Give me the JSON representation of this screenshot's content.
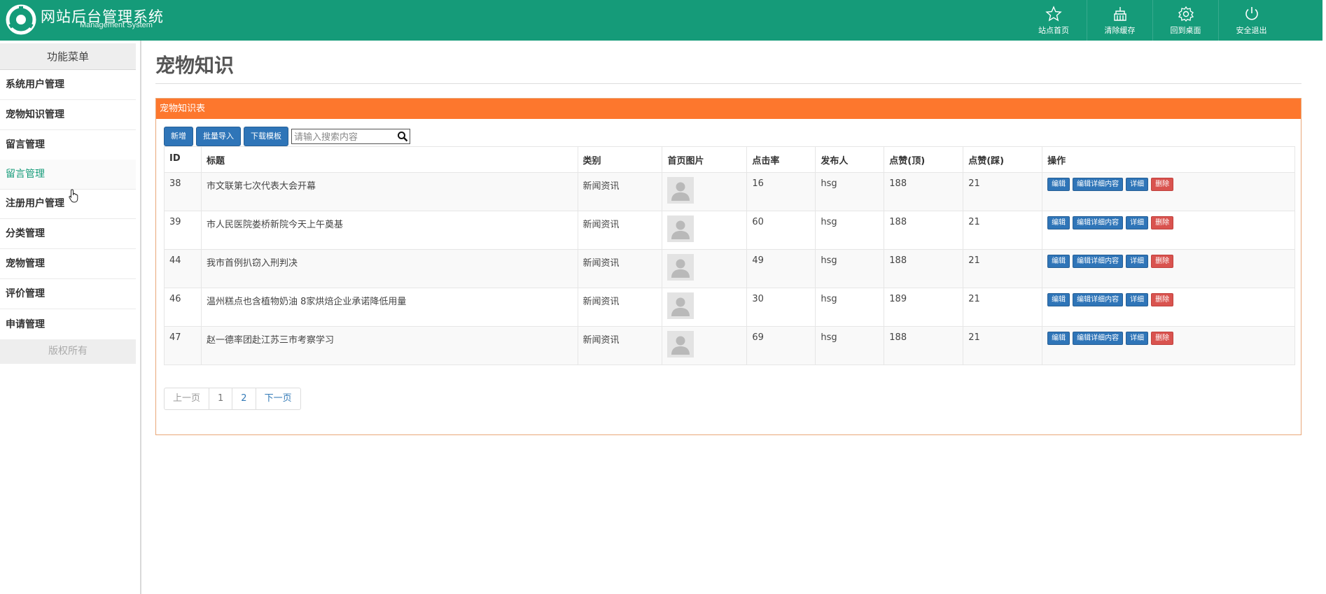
{
  "header": {
    "title": "网站后台管理系统",
    "subtitle": "Management System",
    "nav": [
      {
        "label": "站点首页",
        "icon": "star-icon"
      },
      {
        "label": "清除缓存",
        "icon": "broom-icon"
      },
      {
        "label": "回到桌面",
        "icon": "gear-icon"
      },
      {
        "label": "安全退出",
        "icon": "power-icon"
      }
    ]
  },
  "sidebar": {
    "heading": "功能菜单",
    "items": [
      {
        "label": "系统用户管理"
      },
      {
        "label": "宠物知识管理"
      },
      {
        "label": "留言管理"
      },
      {
        "label": "留言管理"
      },
      {
        "label": "注册用户管理"
      },
      {
        "label": "分类管理"
      },
      {
        "label": "宠物管理"
      },
      {
        "label": "评价管理"
      },
      {
        "label": "申请管理"
      }
    ],
    "footer": "版权所有"
  },
  "main": {
    "page_title": "宠物知识",
    "panel_title": "宠物知识表",
    "toolbar": {
      "add": "新增",
      "import": "批量导入",
      "template": "下载模板",
      "search_placeholder": "请输入搜索内容"
    },
    "table": {
      "columns": [
        "ID",
        "标题",
        "类别",
        "首页图片",
        "点击率",
        "发布人",
        "点赞(顶)",
        "点赞(踩)",
        "操作"
      ],
      "rows": [
        {
          "id": "38",
          "title": "市文联第七次代表大会开幕",
          "category": "新闻资讯",
          "clicks": "16",
          "publisher": "hsg",
          "up": "188",
          "down": "21"
        },
        {
          "id": "39",
          "title": "市人民医院娄桥新院今天上午奠基",
          "category": "新闻资讯",
          "clicks": "60",
          "publisher": "hsg",
          "up": "188",
          "down": "21"
        },
        {
          "id": "44",
          "title": "我市首例扒窃入刑判决",
          "category": "新闻资讯",
          "clicks": "49",
          "publisher": "hsg",
          "up": "188",
          "down": "21"
        },
        {
          "id": "46",
          "title": "温州糕点也含植物奶油 8家烘焙企业承诺降低用量",
          "category": "新闻资讯",
          "clicks": "30",
          "publisher": "hsg",
          "up": "189",
          "down": "21"
        },
        {
          "id": "47",
          "title": "赵一德率团赴江苏三市考察学习",
          "category": "新闻资讯",
          "clicks": "69",
          "publisher": "hsg",
          "up": "188",
          "down": "21"
        }
      ],
      "ops": {
        "edit": "编辑",
        "edit_detail": "编辑详细内容",
        "detail": "详细",
        "delete": "删除"
      }
    },
    "pager": {
      "prev": "上一页",
      "p1": "1",
      "p2": "2",
      "next": "下一页"
    }
  },
  "colors": {
    "header": "#159b79",
    "panel_head": "#fd772d",
    "primary": "#2f75b8",
    "danger": "#d9534f"
  }
}
